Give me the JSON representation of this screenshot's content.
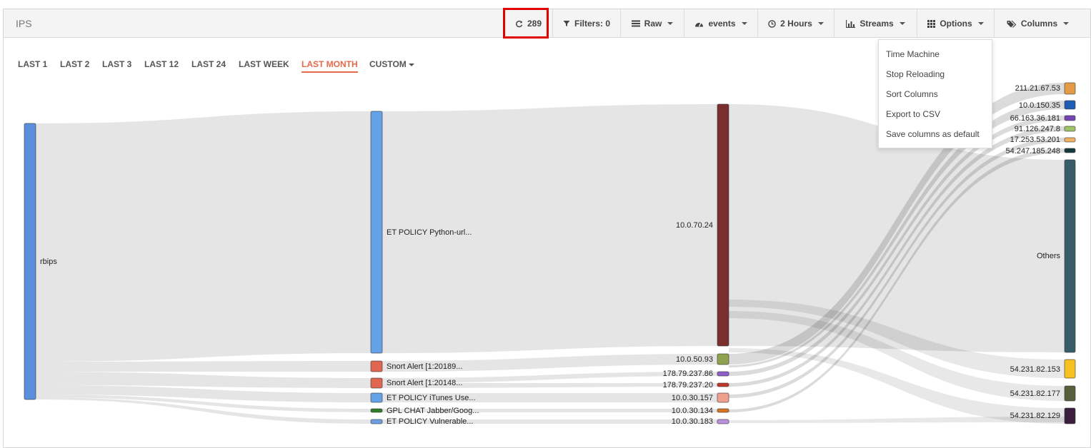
{
  "app": {
    "title": "IPS"
  },
  "toolbar": {
    "refresh_count": "289",
    "filters": "Filters: 0",
    "raw": "Raw",
    "events": "events",
    "time": "2 Hours",
    "streams": "Streams",
    "options": "Options",
    "columns": "Columns"
  },
  "tabs": [
    "LAST 1",
    "LAST 2",
    "LAST 3",
    "LAST 12",
    "LAST 24",
    "LAST WEEK",
    "LAST MONTH",
    "CUSTOM"
  ],
  "active_tab": "LAST MONTH",
  "options_menu": [
    "Time Machine",
    "Stop Reloading",
    "Sort Columns",
    "Export to CSV",
    "Save columns as default"
  ],
  "sankey": {
    "col1": [
      {
        "label": "rbips",
        "color": "#5b8fdd"
      }
    ],
    "col2": [
      {
        "label": "ET POLICY Python-url...",
        "color": "#64a1e6"
      },
      {
        "label": "Snort Alert [1:20189...",
        "color": "#e06651"
      },
      {
        "label": "Snort Alert [1:20148...",
        "color": "#e06651"
      },
      {
        "label": "ET POLICY iTunes Use...",
        "color": "#64a1e6"
      },
      {
        "label": "GPL CHAT Jabber/Goog...",
        "color": "#2f7d2a"
      },
      {
        "label": "ET POLICY Vulnerable...",
        "color": "#6f9fdf"
      }
    ],
    "col3": [
      {
        "label": "10.0.70.24",
        "color": "#7a2e2e"
      },
      {
        "label": "10.0.50.93",
        "color": "#8fa24f"
      },
      {
        "label": "178.79.237.86",
        "color": "#8e5fc9"
      },
      {
        "label": "178.79.237.20",
        "color": "#c2372c"
      },
      {
        "label": "10.0.30.157",
        "color": "#ef9f8d"
      },
      {
        "label": "10.0.30.134",
        "color": "#d8771f"
      },
      {
        "label": "10.0.30.183",
        "color": "#b991dd"
      }
    ],
    "col4": [
      {
        "label": "211.21.67.53",
        "color": "#e49b48"
      },
      {
        "label": "10.0.150.35",
        "color": "#1e5cb5"
      },
      {
        "label": "66.163.36.181",
        "color": "#7345b0"
      },
      {
        "label": "91.126.247.8",
        "color": "#9ec46a"
      },
      {
        "label": "17.253.53.201",
        "color": "#f0b163"
      },
      {
        "label": "54.247.185.248",
        "color": "#153b3e"
      },
      {
        "label": "Others",
        "color": "#375e68"
      },
      {
        "label": "54.231.82.153",
        "color": "#f7c220"
      },
      {
        "label": "54.231.82.177",
        "color": "#56603a"
      },
      {
        "label": "54.231.82.129",
        "color": "#3d1d3d"
      }
    ]
  }
}
